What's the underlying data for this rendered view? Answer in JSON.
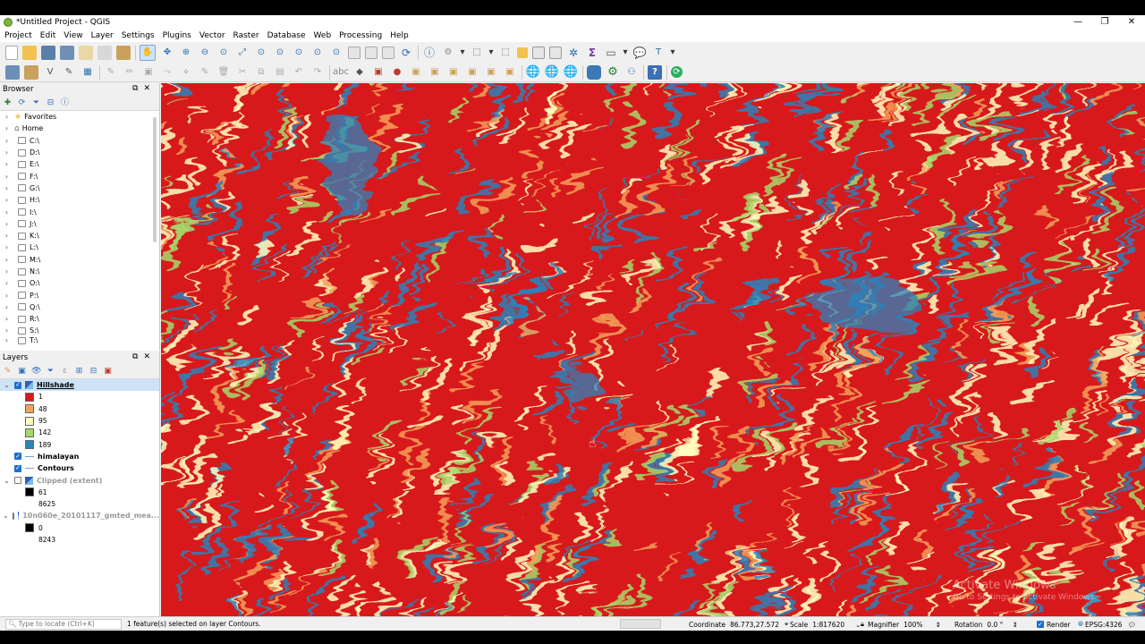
{
  "window": {
    "title": "*Untitled Project - QGIS",
    "controls": {
      "minimize": "—",
      "maximize": "❐",
      "close": "✕"
    }
  },
  "menu": [
    "Project",
    "Edit",
    "View",
    "Layer",
    "Settings",
    "Plugins",
    "Vector",
    "Raster",
    "Database",
    "Web",
    "Processing",
    "Help"
  ],
  "browser": {
    "title": "Browser",
    "items": [
      {
        "label": "Favorites",
        "icon": "star-icon"
      },
      {
        "label": "Home",
        "icon": "home-icon"
      },
      {
        "label": "C:\\",
        "icon": "folder-icon"
      },
      {
        "label": "D:\\",
        "icon": "folder-icon"
      },
      {
        "label": "E:\\",
        "icon": "folder-icon"
      },
      {
        "label": "F:\\",
        "icon": "folder-icon"
      },
      {
        "label": "G:\\",
        "icon": "folder-icon"
      },
      {
        "label": "H:\\",
        "icon": "folder-icon"
      },
      {
        "label": "I:\\",
        "icon": "folder-icon"
      },
      {
        "label": "J:\\",
        "icon": "folder-icon"
      },
      {
        "label": "K:\\",
        "icon": "folder-icon"
      },
      {
        "label": "L:\\",
        "icon": "folder-icon"
      },
      {
        "label": "M:\\",
        "icon": "folder-icon"
      },
      {
        "label": "N:\\",
        "icon": "folder-icon"
      },
      {
        "label": "O:\\",
        "icon": "folder-icon"
      },
      {
        "label": "P:\\",
        "icon": "folder-icon"
      },
      {
        "label": "Q:\\",
        "icon": "folder-icon"
      },
      {
        "label": "R:\\",
        "icon": "folder-icon"
      },
      {
        "label": "S:\\",
        "icon": "folder-icon"
      },
      {
        "label": "T:\\",
        "icon": "folder-icon"
      }
    ]
  },
  "layers": {
    "title": "Layers",
    "hillshade": {
      "name": "Hillshade",
      "legend": [
        {
          "value": "1",
          "color": "#d7191c"
        },
        {
          "value": "48",
          "color": "#f4a259"
        },
        {
          "value": "95",
          "color": "#ffffbf"
        },
        {
          "value": "142",
          "color": "#a6d96a"
        },
        {
          "value": "189",
          "color": "#2b83ba"
        }
      ]
    },
    "himalayan": {
      "name": "himalayan"
    },
    "contours": {
      "name": "Contours"
    },
    "clipped": {
      "name": "Clipped (extent)",
      "min": "61",
      "max": "8625"
    },
    "dem": {
      "name": "10n060e_20101117_gmted_mea...",
      "min": "0",
      "max": "8243"
    }
  },
  "map": {
    "watermark_title": "Activate Windows",
    "watermark_sub": "Go to Settings to activate Windows."
  },
  "status": {
    "locate_placeholder": "Type to locate (Ctrl+K)",
    "message": "1 feature(s) selected on layer Contours.",
    "coordinate_label": "Coordinate",
    "coordinate": "86.773,27.572",
    "scale_label": "Scale",
    "scale": "1:817620",
    "magnifier_label": "Magnifier",
    "magnifier": "100%",
    "rotation_label": "Rotation",
    "rotation": "0.0 °",
    "render_label": "Render",
    "crs": "EPSG:4326"
  },
  "colors": {
    "map_red": "#d7191c",
    "map_orange": "#f4a259",
    "map_cream": "#ffffbf",
    "map_green": "#a6d96a",
    "map_blue": "#2b83ba",
    "accent": "#1e6fce"
  }
}
